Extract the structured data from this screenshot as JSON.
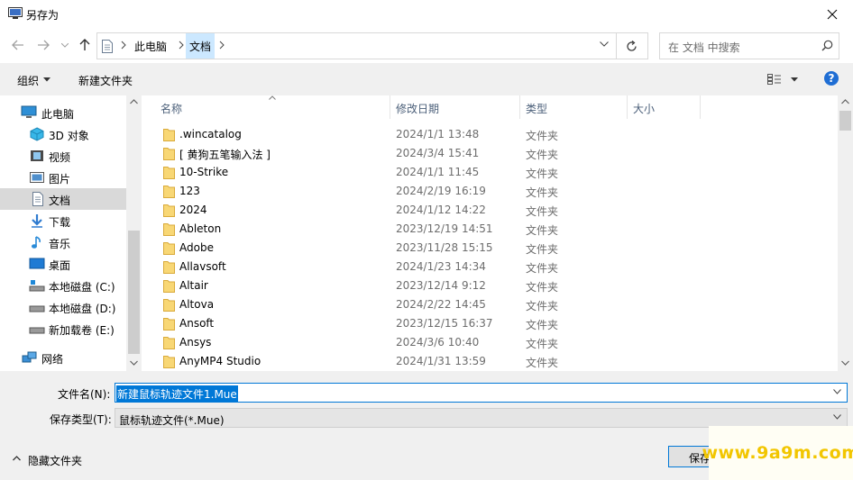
{
  "window": {
    "title": "另存为"
  },
  "nav": {
    "breadcrumbs": [
      "此电脑",
      "文档"
    ],
    "search_placeholder": "在 文档 中搜索"
  },
  "toolbar": {
    "organize_label": "组织",
    "new_folder_label": "新建文件夹"
  },
  "sidebar": {
    "items": [
      {
        "label": "此电脑",
        "icon": "computer-icon"
      },
      {
        "label": "3D 对象",
        "icon": "3d-objects-icon"
      },
      {
        "label": "视频",
        "icon": "video-icon"
      },
      {
        "label": "图片",
        "icon": "pictures-icon"
      },
      {
        "label": "文档",
        "icon": "documents-icon",
        "selected": true
      },
      {
        "label": "下载",
        "icon": "download-icon"
      },
      {
        "label": "音乐",
        "icon": "music-icon"
      },
      {
        "label": "桌面",
        "icon": "desktop-icon"
      },
      {
        "label": "本地磁盘 (C:)",
        "icon": "drive-c-icon"
      },
      {
        "label": "本地磁盘 (D:)",
        "icon": "drive-icon"
      },
      {
        "label": "新加载卷 (E:)",
        "icon": "drive-icon"
      },
      {
        "label": "网络",
        "icon": "network-icon"
      }
    ]
  },
  "files": {
    "columns": [
      "名称",
      "修改日期",
      "类型",
      "大小"
    ],
    "rows": [
      {
        "name": ".wincatalog",
        "date": "2024/1/1 13:48",
        "type": "文件夹"
      },
      {
        "name": "[ 黄狗五笔输入法 ]",
        "date": "2024/3/4 15:41",
        "type": "文件夹"
      },
      {
        "name": "10-Strike",
        "date": "2024/1/1 11:45",
        "type": "文件夹"
      },
      {
        "name": "123",
        "date": "2024/2/19 16:19",
        "type": "文件夹"
      },
      {
        "name": "2024",
        "date": "2024/1/12 14:22",
        "type": "文件夹"
      },
      {
        "name": "Ableton",
        "date": "2023/12/19 14:51",
        "type": "文件夹"
      },
      {
        "name": "Adobe",
        "date": "2023/11/28 15:15",
        "type": "文件夹"
      },
      {
        "name": "Allavsoft",
        "date": "2024/1/23 14:34",
        "type": "文件夹"
      },
      {
        "name": "Altair",
        "date": "2023/12/14 9:12",
        "type": "文件夹"
      },
      {
        "name": "Altova",
        "date": "2024/2/22 14:45",
        "type": "文件夹"
      },
      {
        "name": "Ansoft",
        "date": "2023/12/15 16:37",
        "type": "文件夹"
      },
      {
        "name": "Ansys",
        "date": "2024/3/6 10:40",
        "type": "文件夹"
      },
      {
        "name": "AnyMP4 Studio",
        "date": "2024/1/31 13:59",
        "type": "文件夹"
      }
    ]
  },
  "form": {
    "filename_label": "文件名(N):",
    "filename_value": "新建鼠标轨迹文件1.Mue",
    "filetype_label": "保存类型(T):",
    "filetype_value": "鼠标轨迹文件(*.Mue)",
    "hide_folders_label": "隐藏文件夹",
    "save_label": "保存"
  },
  "watermark": "www.9a9m.com",
  "colors": {
    "accent": "#0078d7",
    "folder": "#f8d775",
    "selection": "#cce8ff"
  }
}
